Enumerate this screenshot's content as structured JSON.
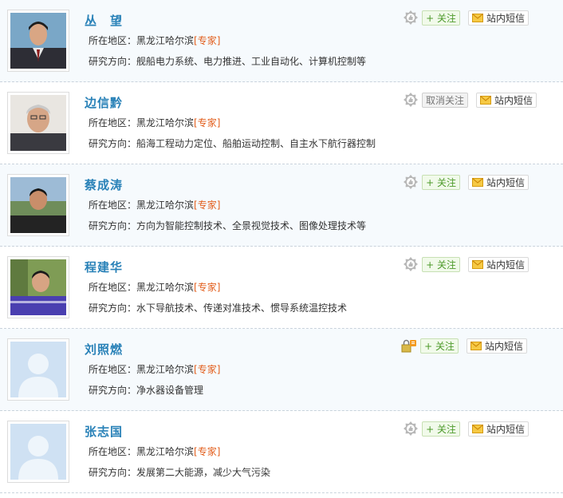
{
  "labels": {
    "region": "所在地区：",
    "research": "研究方向：",
    "expert_tag": "[专家]",
    "follow": "+ 关注",
    "unfollow": "取消关注",
    "message": "站内短信"
  },
  "people": [
    {
      "name": "丛　望",
      "region": "黑龙江哈尔滨",
      "research": "舰船电力系统、电力推进、工业自动化、计算机控制等",
      "follow_label": "+ 关注",
      "followed": false
    },
    {
      "name": "边信黔",
      "region": "黑龙江哈尔滨",
      "research": "船海工程动力定位、船舶运动控制、自主水下航行器控制",
      "follow_label": "取消关注",
      "followed": true
    },
    {
      "name": "蔡成涛",
      "region": "黑龙江哈尔滨",
      "research": "方向为智能控制技术、全景视觉技术、图像处理技术等",
      "follow_label": "+ 关注",
      "followed": false
    },
    {
      "name": "程建华",
      "region": "黑龙江哈尔滨",
      "research": "水下导航技术、传递对准技术、惯导系统温控技术",
      "follow_label": "+ 关注",
      "followed": false
    },
    {
      "name": "刘照燃",
      "region": "黑龙江哈尔滨",
      "research": "净水器设备管理",
      "follow_label": "+ 关注",
      "followed": false
    },
    {
      "name": "张志国",
      "region": "黑龙江哈尔滨",
      "research": "发展第二大能源，减少大气污染",
      "follow_label": "+ 关注",
      "followed": false
    }
  ]
}
